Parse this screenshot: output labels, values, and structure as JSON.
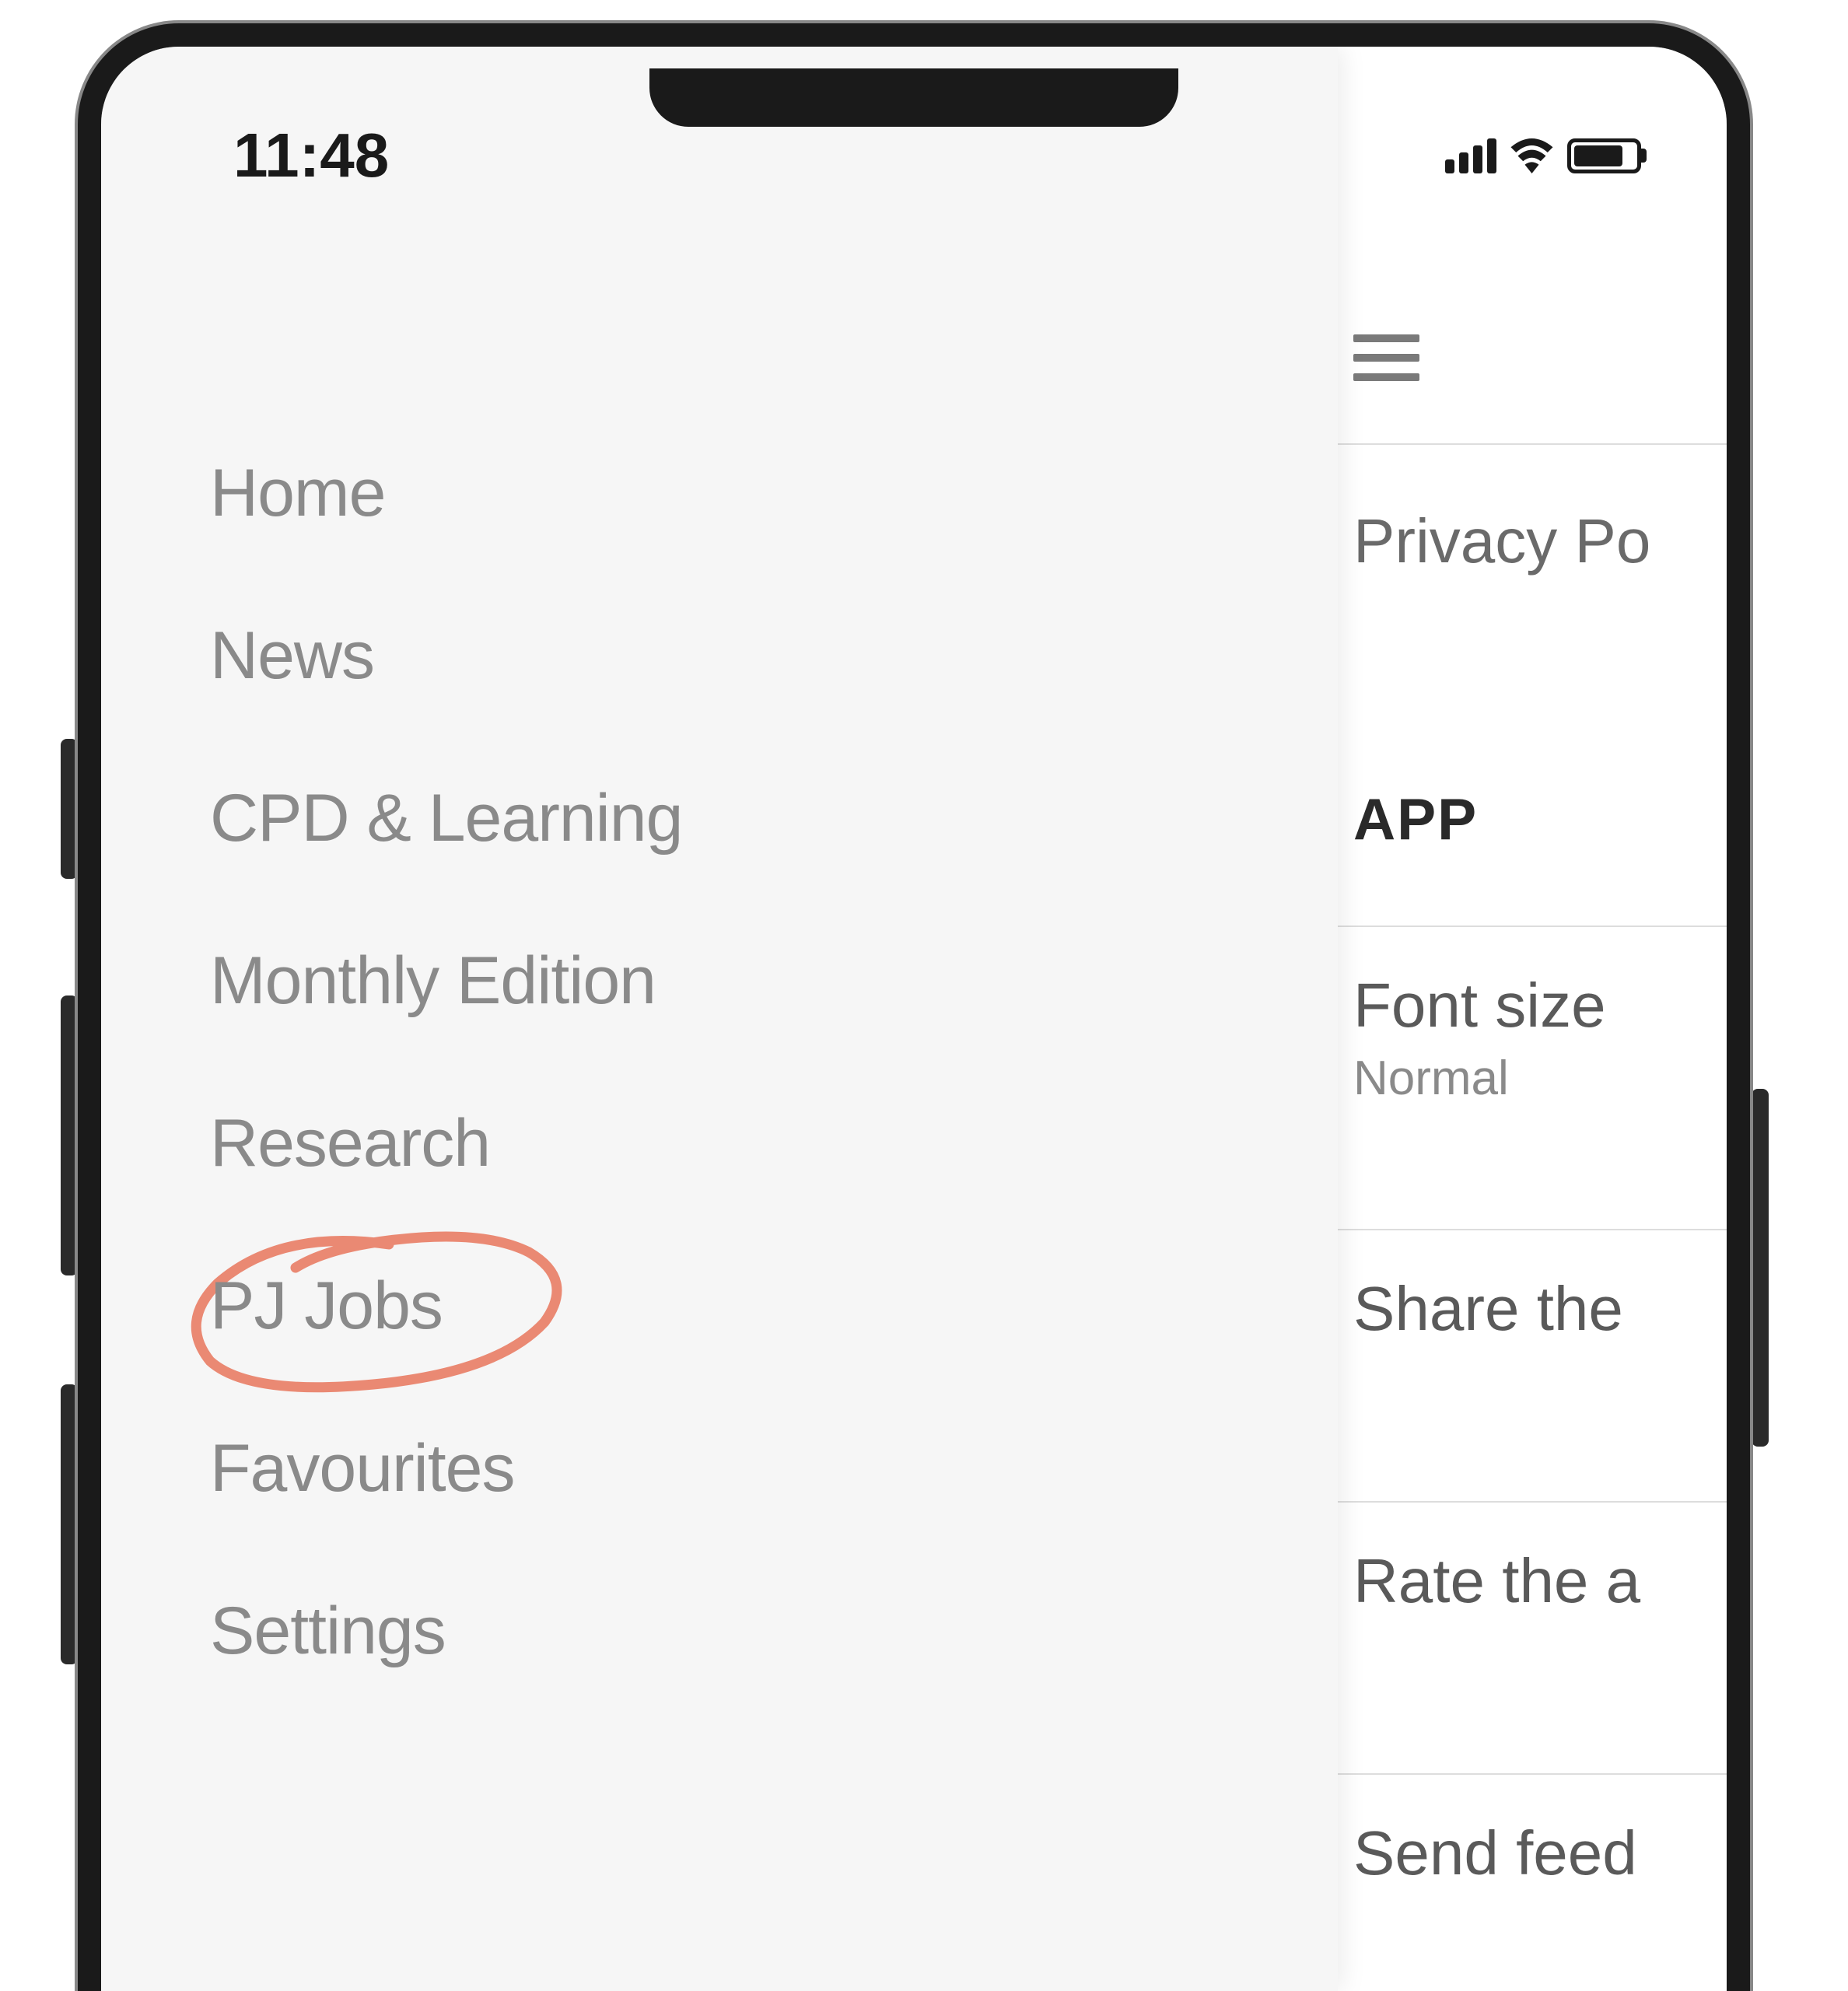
{
  "status_bar": {
    "time": "11:48"
  },
  "drawer": {
    "items": [
      {
        "label": "Home"
      },
      {
        "label": "News"
      },
      {
        "label": "CPD & Learning"
      },
      {
        "label": "Monthly Edition"
      },
      {
        "label": "Research"
      },
      {
        "label": "PJ Jobs",
        "circled": true
      },
      {
        "label": "Favourites"
      },
      {
        "label": "Settings"
      }
    ]
  },
  "main": {
    "privacy_policy": "Privacy Po",
    "section_header": "APP",
    "font_size": {
      "label": "Font size",
      "value": "Normal"
    },
    "share": {
      "label": "Share the"
    },
    "rate": {
      "label": "Rate the a"
    },
    "send": {
      "label": "Send feed"
    }
  },
  "annotation": {
    "circle_color": "#e8755c"
  }
}
